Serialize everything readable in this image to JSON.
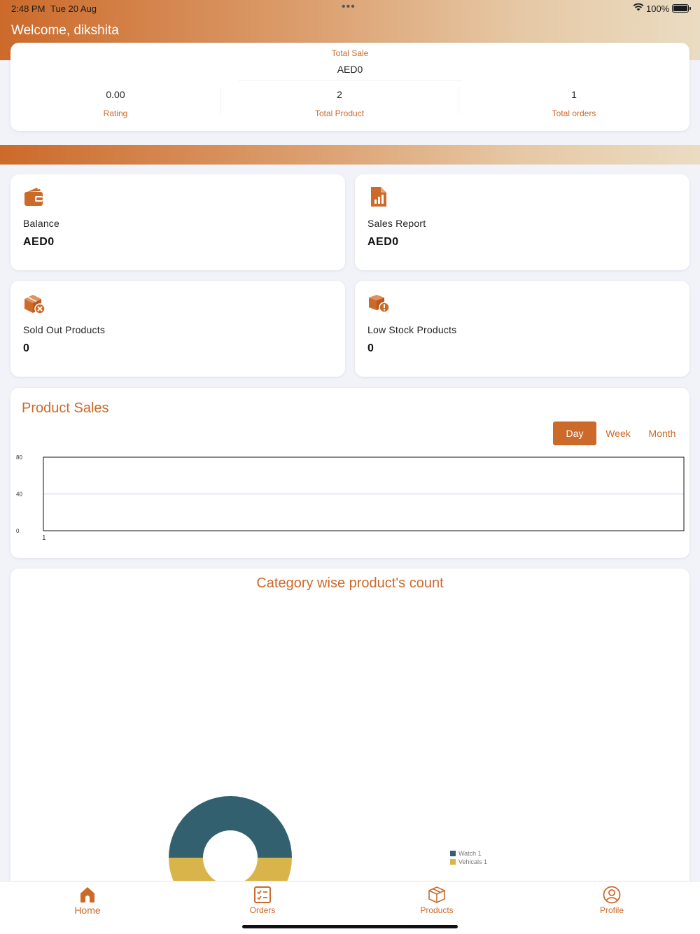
{
  "status_bar": {
    "time": "2:48 PM",
    "date": "Tue 20 Aug",
    "battery": "100%"
  },
  "header": {
    "welcome": "Welcome, dikshita"
  },
  "summary": {
    "total_sale_label": "Total Sale",
    "total_sale_value": "AED0",
    "rating_value": "0.00",
    "rating_label": "Rating",
    "total_product_value": "2",
    "total_product_label": "Total Product",
    "total_orders_value": "1",
    "total_orders_label": "Total orders"
  },
  "tiles": {
    "balance": {
      "label": "Balance",
      "value": "AED0",
      "icon": "wallet-icon"
    },
    "sales_report": {
      "label": "Sales Report",
      "value": "AED0",
      "icon": "report-icon"
    },
    "sold_out": {
      "label": "Sold Out Products",
      "value": "0",
      "icon": "box-remove-icon"
    },
    "low_stock": {
      "label": "Low Stock Products",
      "value": "0",
      "icon": "box-alert-icon"
    }
  },
  "product_sales": {
    "title": "Product Sales",
    "periods": [
      "Day",
      "Week",
      "Month"
    ],
    "selected_period": "Day"
  },
  "chart_data": [
    {
      "type": "line",
      "title": "Product Sales",
      "x": [
        1
      ],
      "series": [
        {
          "values": [
            0
          ]
        }
      ],
      "yticks": [
        0,
        40,
        80
      ],
      "ylim": [
        0,
        80
      ],
      "grid": true
    },
    {
      "type": "pie",
      "title": "Category wise product's count",
      "style": "donut",
      "categories": [
        "Watch",
        "Vehicals"
      ],
      "values": [
        1,
        1
      ],
      "legend": [
        "Watch 1",
        "Vehicals 1"
      ],
      "colors": [
        "#32606e",
        "#d9b44a"
      ],
      "legend_position": "right"
    }
  ],
  "category_chart": {
    "title": "Category wise product's count"
  },
  "tabbar": {
    "home": "Home",
    "orders": "Orders",
    "products": "Products",
    "profile": "Profile"
  },
  "colors": {
    "accent": "#cc6a2a",
    "background": "#f1f3f9"
  }
}
